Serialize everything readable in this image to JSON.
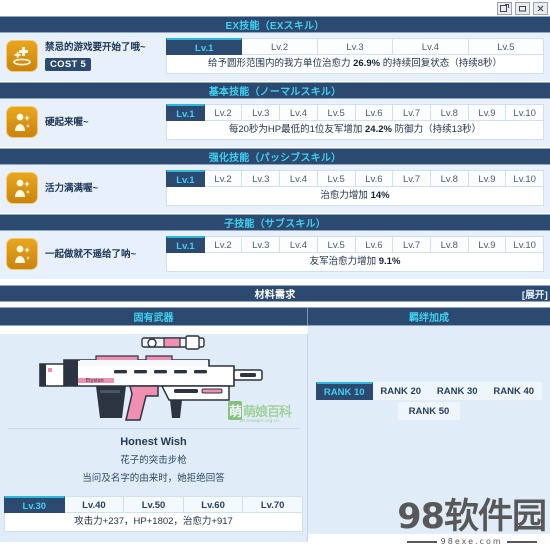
{
  "window": {
    "controls": [
      {
        "name": "restore-window-button",
        "glyph": "↗"
      },
      {
        "name": "minimize-window-button",
        "glyph": "▬"
      },
      {
        "name": "close-window-button",
        "glyph": "✕"
      }
    ]
  },
  "skills": [
    {
      "section_title": "EX技能（EXスキル）",
      "icon_name": "ex-heal-skill-icon",
      "skill_name": "禁忌的游戏要开始了哦~",
      "cost_label": "COST 5",
      "levels": [
        "Lv.1",
        "Lv.2",
        "Lv.3",
        "Lv.4",
        "Lv.5"
      ],
      "active_level": 0,
      "description_pre": "给予圆形范围内的我方单位治愈力 ",
      "description_value": "26.9%",
      "description_post": " 的持续回复状态（持续8秒）"
    },
    {
      "section_title": "基本技能（ノーマルスキル）",
      "icon_name": "normal-skill-icon",
      "skill_name": "硬起来喔~",
      "cost_label": "",
      "levels": [
        "Lv.1",
        "Lv.2",
        "Lv.3",
        "Lv.4",
        "Lv.5",
        "Lv.6",
        "Lv.7",
        "Lv.8",
        "Lv.9",
        "Lv.10"
      ],
      "active_level": 0,
      "description_pre": "每20秒为HP最低的1位友军增加 ",
      "description_value": "24.2%",
      "description_post": " 防御力（持续13秒）"
    },
    {
      "section_title": "强化技能（パッシブスキル）",
      "icon_name": "passive-skill-icon",
      "skill_name": "活力满满喔~",
      "cost_label": "",
      "levels": [
        "Lv.1",
        "Lv.2",
        "Lv.3",
        "Lv.4",
        "Lv.5",
        "Lv.6",
        "Lv.7",
        "Lv.8",
        "Lv.9",
        "Lv.10"
      ],
      "active_level": 0,
      "description_pre": "治愈力增加 ",
      "description_value": "14%",
      "description_post": ""
    },
    {
      "section_title": "子技能（サブスキル）",
      "icon_name": "sub-skill-icon",
      "skill_name": "一起做就不遥给了呐~",
      "cost_label": "",
      "levels": [
        "Lv.1",
        "Lv.2",
        "Lv.3",
        "Lv.4",
        "Lv.5",
        "Lv.6",
        "Lv.7",
        "Lv.8",
        "Lv.9",
        "Lv.10"
      ],
      "active_level": 0,
      "description_pre": "友军治愈力增加 ",
      "description_value": "9.1%",
      "description_post": ""
    }
  ],
  "material": {
    "title": "材料需求",
    "expand_label": "[展开]"
  },
  "weapon": {
    "column_title": "固有武器",
    "name": "Honest Wish",
    "subtitle": "花子的突击步枪",
    "flavor": "当问及名字的由来时，她拒绝回答",
    "levels": [
      "Lv.30",
      "Lv.40",
      "Lv.50",
      "Lv.60",
      "Lv.70"
    ],
    "active_level": 0,
    "stats": "攻击力+237，HP+1802，治愈力+917",
    "watermark": "萌娘百科",
    "watermark_sub": "zh.moegirl.org.cn"
  },
  "bond": {
    "column_title": "羁绊加成",
    "ranks_row1": [
      "RANK 10",
      "RANK 20",
      "RANK 30",
      "RANK 40"
    ],
    "ranks_row2": [
      "RANK 50"
    ],
    "active_rank": 0
  },
  "site_watermark": {
    "title": "98软件园",
    "url": "98exe.com"
  },
  "colors": {
    "header_bg": "#2c4a70",
    "accent_cyan": "#3fd0f0",
    "panel_bg": "#e8f1fb",
    "tab_top": "#2bb9e0",
    "icon_orange": "#e9a61d"
  }
}
